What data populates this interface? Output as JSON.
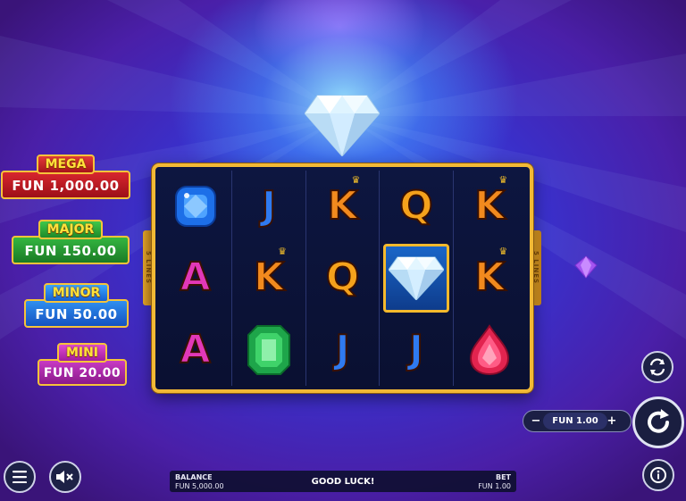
{
  "jackpots": {
    "mega": {
      "title": "MEGA",
      "value": "FUN 1,000.00"
    },
    "major": {
      "title": "MAJOR",
      "value": "FUN 150.00"
    },
    "minor": {
      "title": "MINOR",
      "value": "FUN 50.00"
    },
    "mini": {
      "title": "MINI",
      "value": "FUN 20.00"
    }
  },
  "lines_label": "5 LINES",
  "reels": [
    [
      "blue-gem",
      "A",
      "A"
    ],
    [
      "J",
      "K",
      "green-emerald"
    ],
    [
      "K",
      "Q",
      "J"
    ],
    [
      "Q",
      "diamond",
      "J"
    ],
    [
      "K",
      "K",
      "red-ruby"
    ]
  ],
  "winning_cell": "reel-4-row-2",
  "bottom_bar": {
    "balance_label": "BALANCE",
    "balance_value": "FUN 5,000.00",
    "message": "GOOD LUCK!",
    "bet_label": "BET",
    "bet_value": "FUN 1.00"
  },
  "bet_control": {
    "minus": "−",
    "amount": "FUN 1.00",
    "plus": "+"
  },
  "icons": {
    "menu": "hamburger-icon",
    "sound": "speaker-muted-icon",
    "info": "info-icon",
    "autoplay": "autoplay-icon",
    "spin": "spin-icon"
  },
  "colors": {
    "frame_gold": "#f2b935",
    "background": "#3a2fc9"
  }
}
